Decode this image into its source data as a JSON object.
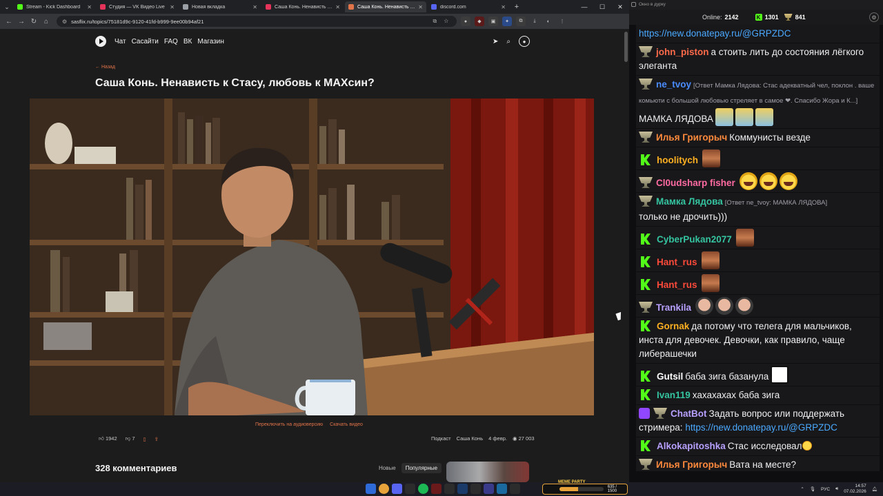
{
  "browser": {
    "tabs": [
      {
        "label": "Stream - Kick Dashboard",
        "color": "#53fc18",
        "active": false
      },
      {
        "label": "Студия — VK Видео Live",
        "color": "#e5335a",
        "active": false
      },
      {
        "label": "Новая вкладка",
        "color": "#9aa0a6",
        "active": false
      },
      {
        "label": "Саша Конь. Ненависть к Стасу",
        "color": "#e5335a",
        "active": false
      },
      {
        "label": "Саша Конь. Ненависть к С",
        "color": "#e2744a",
        "active": true
      },
      {
        "label": "discord.com",
        "color": "#5865f2",
        "active": false
      }
    ],
    "url": "sasflix.ru/topics/75181d9c-9120-41fd-b999-9ee00b94af21"
  },
  "site": {
    "nav": [
      "Чат",
      "Сасайти",
      "FAQ",
      "ВК",
      "Магазин"
    ],
    "back_label": "← Назад",
    "title": "Саша Конь. Ненависть к Стасу, любовь к МАХсин?",
    "audio_link": "Переключить на аудиоверсию",
    "download_link": "Скачать видео",
    "likes": "1942",
    "dislikes": "7",
    "tag1": "Подкаст",
    "tag2": "Саша Конь",
    "date": "4 февр.",
    "views": "27 003",
    "comments_title": "328 комментариев",
    "sort_new": "Новые",
    "sort_popular": "Популярные"
  },
  "chat": {
    "window_title": "Окно в дурку",
    "online_label": "Online:",
    "online_value": "2142",
    "kick_count": "1301",
    "cup_count": "841",
    "messages": [
      {
        "badge": "none",
        "nick": "",
        "nick_color": "#ffffff",
        "reply": "",
        "text": "",
        "link": "https://new.donatepay.ru/@GRPZDC",
        "emotes": []
      },
      {
        "badge": "cup",
        "nick": "john_piston",
        "nick_color": "#ff6b4a",
        "reply": "",
        "text": "а стоить лить до состояния лёгкого элеганта",
        "link": "",
        "emotes": []
      },
      {
        "badge": "cup",
        "nick": "ne_tvoy",
        "nick_color": "#4a8cff",
        "reply": "[Ответ Мамка Лядова: Стас адекватный чел, поклон . ваше комьюти с большой любовью стреляет в самое ❤. Спасибо Жора и К...]",
        "text": "МАМКА ЛЯДОВА",
        "link": "",
        "emotes": [
          "cat",
          "cat",
          "cat"
        ]
      },
      {
        "badge": "cup",
        "nick": "Илья Григорыч",
        "nick_color": "#ff8a3c",
        "reply": "",
        "text": "Коммунисты везде",
        "link": "",
        "emotes": []
      },
      {
        "badge": "k",
        "nick": "hoolitych",
        "nick_color": "#ffb020",
        "reply": "",
        "text": "",
        "link": "",
        "emotes": [
          "face"
        ]
      },
      {
        "badge": "cup",
        "nick": "Cl0udsharp fisher",
        "nick_color": "#ff6ba0",
        "reply": "",
        "text": "",
        "link": "",
        "emotes": [
          "laugh",
          "laugh",
          "laugh"
        ]
      },
      {
        "badge": "cup",
        "nick": "Мамка Лядова",
        "nick_color": "#35c4a0",
        "reply": "[Ответ ne_tvoy: МАМКА ЛЯДОВА]",
        "text": "только не дрочить)))",
        "link": "",
        "emotes": []
      },
      {
        "badge": "k",
        "nick": "CyberPukan2077",
        "nick_color": "#35c4a0",
        "reply": "",
        "text": "",
        "link": "",
        "emotes": [
          "face"
        ]
      },
      {
        "badge": "k",
        "nick": "Hant_rus",
        "nick_color": "#ff4a3a",
        "reply": "",
        "text": "",
        "link": "",
        "emotes": [
          "face"
        ]
      },
      {
        "badge": "k",
        "nick": "Hant_rus",
        "nick_color": "#ff4a3a",
        "reply": "",
        "text": "",
        "link": "",
        "emotes": [
          "face"
        ]
      },
      {
        "badge": "cup",
        "nick": "Trankila",
        "nick_color": "#b8a0ff",
        "reply": "",
        "text": "",
        "link": "",
        "emotes": [
          "bald",
          "bald",
          "bald"
        ]
      },
      {
        "badge": "k",
        "nick": "Gornak",
        "nick_color": "#ffb020",
        "reply": "",
        "text": "да потому что телега для мальчиков, инста для девочек. Девочки, как правило, чаще либерашечки",
        "link": "",
        "emotes": []
      },
      {
        "badge": "k",
        "nick": "Gutsil",
        "nick_color": "#ffffff",
        "reply": "",
        "text": "баба зига базанула",
        "link": "",
        "emotes": [
          "grin"
        ]
      },
      {
        "badge": "k",
        "nick": "Ivan119",
        "nick_color": "#35c4a0",
        "reply": "",
        "text": "хахахахах баба зига",
        "link": "",
        "emotes": []
      },
      {
        "badge": "bot",
        "nick": "ChatBot",
        "nick_color": "#b8a0ff",
        "reply": "",
        "text": "Задать вопрос или поддержать стримера:",
        "link": "https://new.donatepay.ru/@GRPZDC",
        "emotes": []
      },
      {
        "badge": "k",
        "nick": "Alkokapitoshka",
        "nick_color": "#b8a0ff",
        "reply": "",
        "text": "Стас исследовал",
        "link": "",
        "emotes": [
          "blush"
        ]
      },
      {
        "badge": "cup",
        "nick": "Илья Григорыч",
        "nick_color": "#ff8a3c",
        "reply": "",
        "text": "Вата на месте?",
        "link": "",
        "emotes": []
      }
    ]
  },
  "taskbar": {
    "meme_title": "MEME PARTY",
    "meme_progress": "635 / 1500",
    "meme_fraction": 0.42,
    "lang": "РУС",
    "time": "14:57",
    "date": "07.02.2026"
  }
}
